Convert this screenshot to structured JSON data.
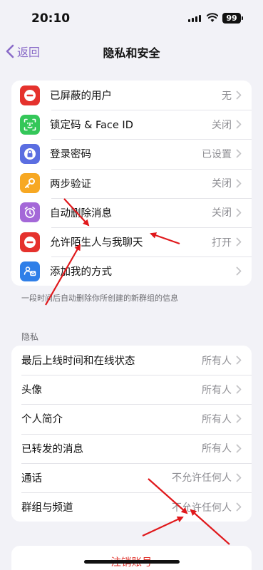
{
  "status": {
    "time": "20:10",
    "battery": "99"
  },
  "nav": {
    "back_label": "返回",
    "title": "隐私和安全"
  },
  "security_items": [
    {
      "label": "已屏蔽的用户",
      "value": "无",
      "icon": "block-icon",
      "color": "#e5322d"
    },
    {
      "label": "锁定码 & Face ID",
      "value": "关闭",
      "icon": "face-id-icon",
      "color": "#34c759"
    },
    {
      "label": "登录密码",
      "value": "已设置",
      "icon": "lock-icon",
      "color": "#5b6ee1"
    },
    {
      "label": "两步验证",
      "value": "关闭",
      "icon": "key-icon",
      "color": "#f7a823"
    },
    {
      "label": "自动删除消息",
      "value": "关闭",
      "icon": "alarm-clock-icon",
      "color": "#a468d8"
    },
    {
      "label": "允许陌生人与我聊天",
      "value": "打开",
      "icon": "block-icon",
      "color": "#e5322d"
    },
    {
      "label": "添加我的方式",
      "value": "",
      "icon": "add-contact-icon",
      "color": "#2f7fe8"
    }
  ],
  "caption": "一段时间后自动删除你所创建的新群组的信息",
  "privacy_header": "隐私",
  "privacy_items": [
    {
      "label": "最后上线时间和在线状态",
      "value": "所有人"
    },
    {
      "label": "头像",
      "value": "所有人"
    },
    {
      "label": "个人简介",
      "value": "所有人"
    },
    {
      "label": "已转发的消息",
      "value": "所有人"
    },
    {
      "label": "通话",
      "value": "不允许任何人"
    },
    {
      "label": "群组与频道",
      "value": "不允许任何人"
    }
  ],
  "logout_label": "注销账号",
  "colors": {
    "accent": "#8a6bc8",
    "annotation": "#e0181b",
    "destructive": "#e0332c"
  }
}
